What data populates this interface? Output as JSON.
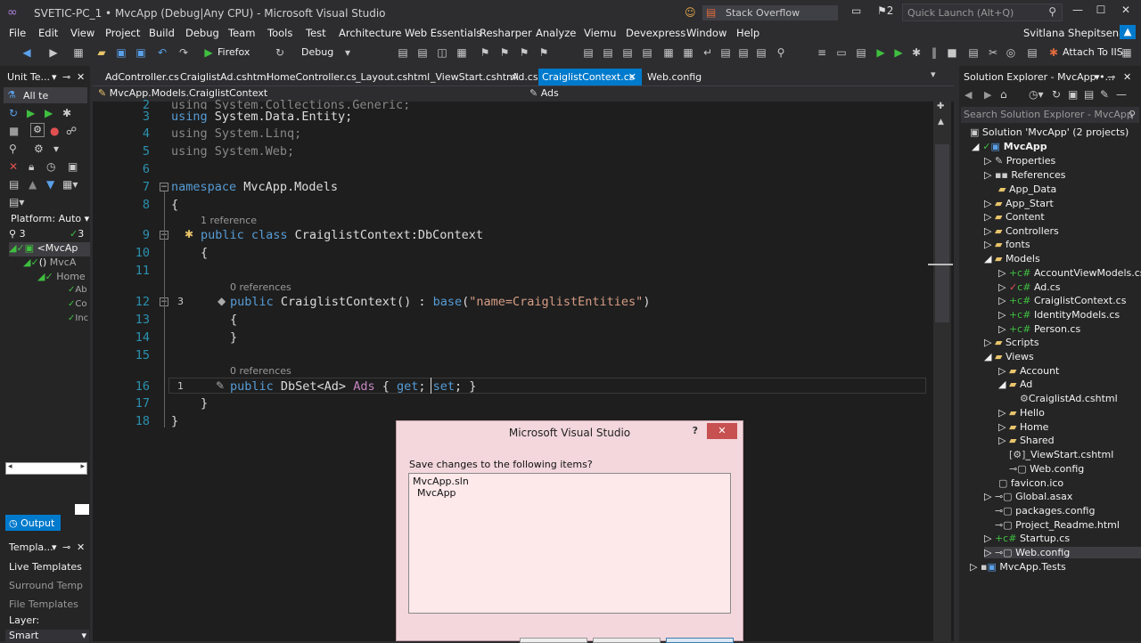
{
  "title_bar": {
    "title": "SVETIC-PC_1 • MvcApp (Debug|Any CPU) - Microsoft Visual Studio",
    "stack_overflow": "Stack Overflow",
    "notifications": "2",
    "quick_launch": "Quick Launch (Alt+Q)"
  },
  "menu": [
    "File",
    "Edit",
    "View",
    "Project",
    "Build",
    "Debug",
    "Team",
    "Tools",
    "Test",
    "Architecture",
    "Web Essentials",
    "Resharper",
    "Analyze",
    "Viemu",
    "Devexpress",
    "Window",
    "Help"
  ],
  "user": "Svitlana Shepitsena",
  "toolbar": {
    "browser": "Firefox",
    "config": "Debug",
    "attach": "Attach To IIS"
  },
  "left_panel": {
    "unit_test_title": "Unit Te...",
    "all_tests": "All te",
    "platform": "Platform: Auto",
    "tree_counts": [
      "3",
      "3"
    ],
    "tree_items": [
      "<MvcAp",
      "MvcA",
      "Home",
      "Ab",
      "Co",
      "Inc"
    ],
    "output_label": "Output",
    "templates_title": "Templa...",
    "templates_items": [
      "Live Templates",
      "Surround Temp",
      "File Templates"
    ],
    "layer_label": "Layer:",
    "layer_value": "Smart"
  },
  "tabs": [
    "AdController.cs",
    "CraiglistAd.cshtml",
    "HomeController.cs",
    "_Layout.cshtml",
    "_ViewStart.cshtml",
    "Ad.cs",
    "CraiglistContext.cs",
    "Web.config"
  ],
  "active_tab": "CraiglistContext.cs",
  "nav": {
    "left": "MvcApp.Models.CraiglistContext",
    "right": "Ads"
  },
  "code": {
    "line2": "using System.Collections.Generic;",
    "line3": "using System.Data.Entity;",
    "line4": "using System.Linq;",
    "line5": "using System.Web;",
    "line7": "namespace MvcApp.Models",
    "line8": "{",
    "ref9": "1 reference",
    "line9": "public class CraiglistContext:DbContext",
    "line10": "{",
    "ref12": "0 references",
    "line12": "public CraiglistContext() : base(\"name=CraiglistEntities\")",
    "line13": "{",
    "line14": "}",
    "ref16": "0 references",
    "line16": "public DbSet<Ad> Ads { get; set; }",
    "line17": "}",
    "line18": "}",
    "markers": {
      "12": "3",
      "16": "1"
    },
    "line_numbers": [
      "2",
      "3",
      "4",
      "5",
      "6",
      "7",
      "8",
      "9",
      "10",
      "11",
      "12",
      "13",
      "14",
      "15",
      "16",
      "17",
      "18"
    ]
  },
  "solution_explorer": {
    "title": "Solution Explorer - MvcApp •...",
    "search": "Search Solution Explorer - MvcApp",
    "items": [
      "Solution 'MvcApp' (2 projects)",
      "MvcApp",
      "Properties",
      "References",
      "App_Data",
      "App_Start",
      "Content",
      "Controllers",
      "fonts",
      "Models",
      "AccountViewModels.cs",
      "Ad.cs",
      "CraiglistContext.cs",
      "IdentityModels.cs",
      "Person.cs",
      "Scripts",
      "Views",
      "Account",
      "Ad",
      "CraiglistAd.cshtml",
      "Hello",
      "Home",
      "Shared",
      "_ViewStart.cshtml",
      "Web.config",
      "favicon.ico",
      "Global.asax",
      "packages.config",
      "Project_Readme.html",
      "Startup.cs",
      "Web.config",
      "MvcApp.Tests"
    ]
  },
  "dialog": {
    "title": "Microsoft Visual Studio",
    "help": "?",
    "close": "✕",
    "prompt": "Save changes to the following items?",
    "items": [
      "MvcApp.sln",
      "MvcApp"
    ]
  }
}
